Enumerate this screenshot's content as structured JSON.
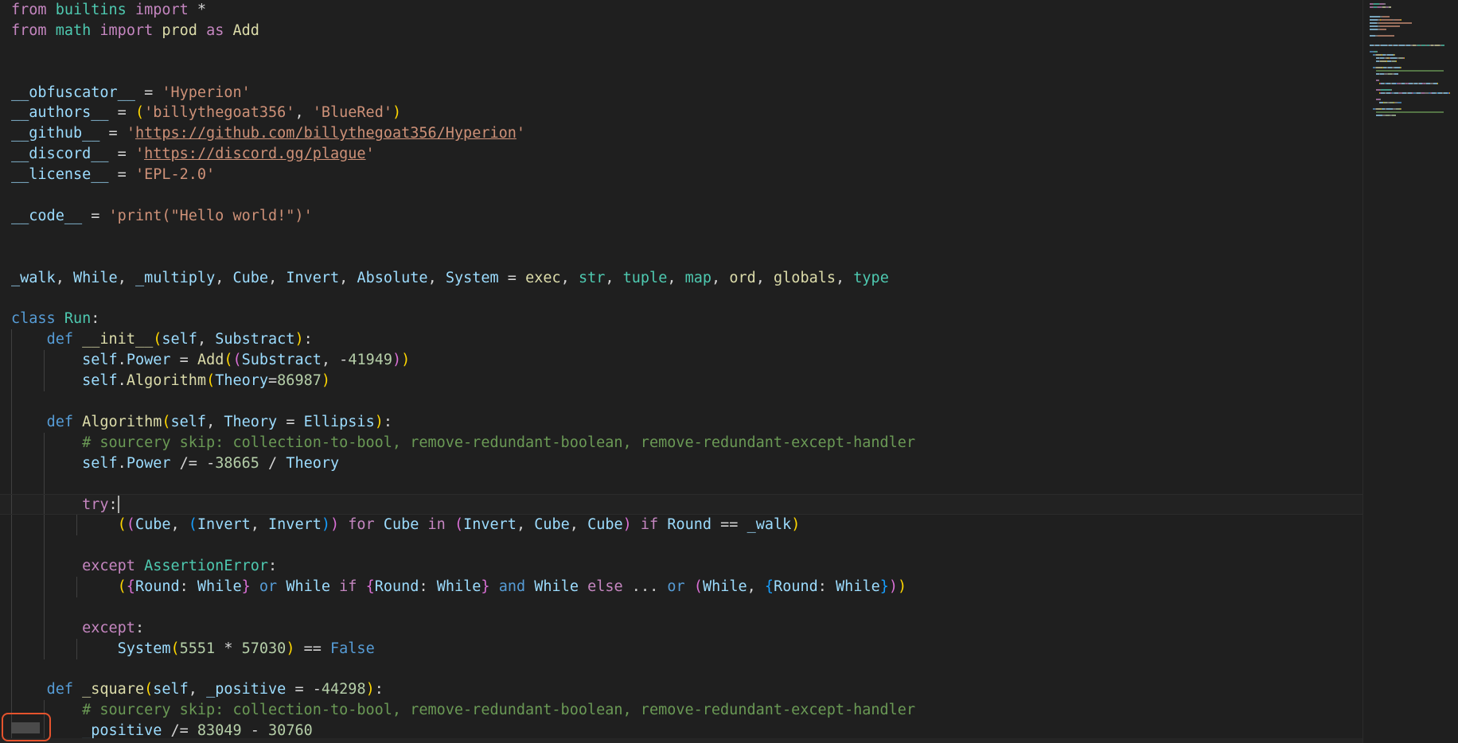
{
  "editor": {
    "lines": [
      {
        "tokens": [
          [
            "kc",
            "from"
          ],
          [
            "op",
            " "
          ],
          [
            "ty",
            "builtins"
          ],
          [
            "op",
            " "
          ],
          [
            "kc",
            "import"
          ],
          [
            "op",
            " *"
          ]
        ]
      },
      {
        "tokens": [
          [
            "kc",
            "from"
          ],
          [
            "op",
            " "
          ],
          [
            "ty",
            "math"
          ],
          [
            "op",
            " "
          ],
          [
            "kc",
            "import"
          ],
          [
            "op",
            " "
          ],
          [
            "fn",
            "prod"
          ],
          [
            "op",
            " "
          ],
          [
            "kc",
            "as"
          ],
          [
            "op",
            " "
          ],
          [
            "fn",
            "Add"
          ]
        ]
      },
      {
        "tokens": []
      },
      {
        "tokens": []
      },
      {
        "tokens": [
          [
            "vr",
            "__obfuscator__"
          ],
          [
            "op",
            " = "
          ],
          [
            "st",
            "'Hyperion'"
          ]
        ]
      },
      {
        "tokens": [
          [
            "vr",
            "__authors__"
          ],
          [
            "op",
            " = "
          ],
          [
            "b1",
            "("
          ],
          [
            "st",
            "'billythegoat356'"
          ],
          [
            "op",
            ", "
          ],
          [
            "st",
            "'BlueRed'"
          ],
          [
            "b1",
            ")"
          ]
        ]
      },
      {
        "tokens": [
          [
            "vr",
            "__github__"
          ],
          [
            "op",
            " = "
          ],
          [
            "st",
            "'"
          ],
          [
            "st ul",
            "https://github.com/billythegoat356/Hyperion"
          ],
          [
            "st",
            "'"
          ]
        ]
      },
      {
        "tokens": [
          [
            "vr",
            "__discord__"
          ],
          [
            "op",
            " = "
          ],
          [
            "st",
            "'"
          ],
          [
            "st ul",
            "https://discord.gg/plague"
          ],
          [
            "st",
            "'"
          ]
        ]
      },
      {
        "tokens": [
          [
            "vr",
            "__license__"
          ],
          [
            "op",
            " = "
          ],
          [
            "st",
            "'EPL-2.0'"
          ]
        ]
      },
      {
        "tokens": []
      },
      {
        "tokens": [
          [
            "vr",
            "__code__"
          ],
          [
            "op",
            " = "
          ],
          [
            "st",
            "'print(\"Hello world!\")'"
          ]
        ]
      },
      {
        "tokens": []
      },
      {
        "tokens": []
      },
      {
        "tokens": [
          [
            "vr",
            "_walk"
          ],
          [
            "op",
            ", "
          ],
          [
            "vr",
            "While"
          ],
          [
            "op",
            ", "
          ],
          [
            "vr",
            "_multiply"
          ],
          [
            "op",
            ", "
          ],
          [
            "vr",
            "Cube"
          ],
          [
            "op",
            ", "
          ],
          [
            "vr",
            "Invert"
          ],
          [
            "op",
            ", "
          ],
          [
            "vr",
            "Absolute"
          ],
          [
            "op",
            ", "
          ],
          [
            "vr",
            "System"
          ],
          [
            "op",
            " = "
          ],
          [
            "fn",
            "exec"
          ],
          [
            "op",
            ", "
          ],
          [
            "ty",
            "str"
          ],
          [
            "op",
            ", "
          ],
          [
            "ty",
            "tuple"
          ],
          [
            "op",
            ", "
          ],
          [
            "ty",
            "map"
          ],
          [
            "op",
            ", "
          ],
          [
            "fn",
            "ord"
          ],
          [
            "op",
            ", "
          ],
          [
            "fn",
            "globals"
          ],
          [
            "op",
            ", "
          ],
          [
            "ty",
            "type"
          ]
        ]
      },
      {
        "tokens": []
      },
      {
        "tokens": [
          [
            "kw",
            "class"
          ],
          [
            "op",
            " "
          ],
          [
            "ty",
            "Run"
          ],
          [
            "op",
            ":"
          ]
        ]
      },
      {
        "indent": 1,
        "tokens": [
          [
            "kw",
            "def"
          ],
          [
            "op",
            " "
          ],
          [
            "fn",
            "__init__"
          ],
          [
            "b1",
            "("
          ],
          [
            "vr",
            "self"
          ],
          [
            "op",
            ", "
          ],
          [
            "vr",
            "Substract"
          ],
          [
            "b1",
            ")"
          ],
          [
            "op",
            ":"
          ]
        ]
      },
      {
        "indent": 2,
        "tokens": [
          [
            "vr",
            "self"
          ],
          [
            "op",
            "."
          ],
          [
            "vr",
            "Power"
          ],
          [
            "op",
            " = "
          ],
          [
            "fn",
            "Add"
          ],
          [
            "b1",
            "("
          ],
          [
            "b2",
            "("
          ],
          [
            "vr",
            "Substract"
          ],
          [
            "op",
            ", "
          ],
          [
            "op",
            "-"
          ],
          [
            "nu",
            "41949"
          ],
          [
            "b2",
            ")"
          ],
          [
            "b1",
            ")"
          ]
        ]
      },
      {
        "indent": 2,
        "tokens": [
          [
            "vr",
            "self"
          ],
          [
            "op",
            "."
          ],
          [
            "fn",
            "Algorithm"
          ],
          [
            "b1",
            "("
          ],
          [
            "vr",
            "Theory"
          ],
          [
            "op",
            "="
          ],
          [
            "nu",
            "86987"
          ],
          [
            "b1",
            ")"
          ]
        ]
      },
      {
        "indent": 1,
        "tokens": []
      },
      {
        "indent": 1,
        "tokens": [
          [
            "kw",
            "def"
          ],
          [
            "op",
            " "
          ],
          [
            "fn",
            "Algorithm"
          ],
          [
            "b1",
            "("
          ],
          [
            "vr",
            "self"
          ],
          [
            "op",
            ", "
          ],
          [
            "vr",
            "Theory"
          ],
          [
            "op",
            " = "
          ],
          [
            "vr",
            "Ellipsis"
          ],
          [
            "b1",
            ")"
          ],
          [
            "op",
            ":"
          ]
        ]
      },
      {
        "indent": 2,
        "tokens": [
          [
            "cm",
            "# sourcery skip: collection-to-bool, remove-redundant-boolean, remove-redundant-except-handler"
          ]
        ]
      },
      {
        "indent": 2,
        "tokens": [
          [
            "vr",
            "self"
          ],
          [
            "op",
            "."
          ],
          [
            "vr",
            "Power"
          ],
          [
            "op",
            " /= -"
          ],
          [
            "nu",
            "38665"
          ],
          [
            "op",
            " / "
          ],
          [
            "vr",
            "Theory"
          ]
        ]
      },
      {
        "indent": 2,
        "tokens": []
      },
      {
        "indent": 2,
        "current": true,
        "tokens": [
          [
            "kc",
            "try"
          ],
          [
            "op",
            ":"
          ],
          [
            "cursor",
            ""
          ]
        ]
      },
      {
        "indent": 3,
        "tokens": [
          [
            "b1",
            "("
          ],
          [
            "b2",
            "("
          ],
          [
            "vr",
            "Cube"
          ],
          [
            "op",
            ", "
          ],
          [
            "b3",
            "("
          ],
          [
            "vr",
            "Invert"
          ],
          [
            "op",
            ", "
          ],
          [
            "vr",
            "Invert"
          ],
          [
            "b3",
            ")"
          ],
          [
            "b2",
            ")"
          ],
          [
            "op",
            " "
          ],
          [
            "kc",
            "for"
          ],
          [
            "op",
            " "
          ],
          [
            "vr",
            "Cube"
          ],
          [
            "op",
            " "
          ],
          [
            "kc",
            "in"
          ],
          [
            "op",
            " "
          ],
          [
            "b2",
            "("
          ],
          [
            "vr",
            "Invert"
          ],
          [
            "op",
            ", "
          ],
          [
            "vr",
            "Cube"
          ],
          [
            "op",
            ", "
          ],
          [
            "vr",
            "Cube"
          ],
          [
            "b2",
            ")"
          ],
          [
            "op",
            " "
          ],
          [
            "kc",
            "if"
          ],
          [
            "op",
            " "
          ],
          [
            "vr",
            "Round"
          ],
          [
            "op",
            " == "
          ],
          [
            "vr",
            "_walk"
          ],
          [
            "b1",
            ")"
          ]
        ]
      },
      {
        "indent": 2,
        "tokens": []
      },
      {
        "indent": 2,
        "tokens": [
          [
            "kc",
            "except"
          ],
          [
            "op",
            " "
          ],
          [
            "ty",
            "AssertionError"
          ],
          [
            "op",
            ":"
          ]
        ]
      },
      {
        "indent": 3,
        "tokens": [
          [
            "b1",
            "("
          ],
          [
            "b2",
            "{"
          ],
          [
            "vr",
            "Round"
          ],
          [
            "op",
            ": "
          ],
          [
            "vr",
            "While"
          ],
          [
            "b2",
            "}"
          ],
          [
            "op",
            " "
          ],
          [
            "kw",
            "or"
          ],
          [
            "op",
            " "
          ],
          [
            "vr",
            "While"
          ],
          [
            "op",
            " "
          ],
          [
            "kc",
            "if"
          ],
          [
            "op",
            " "
          ],
          [
            "b2",
            "{"
          ],
          [
            "vr",
            "Round"
          ],
          [
            "op",
            ": "
          ],
          [
            "vr",
            "While"
          ],
          [
            "b2",
            "}"
          ],
          [
            "op",
            " "
          ],
          [
            "kw",
            "and"
          ],
          [
            "op",
            " "
          ],
          [
            "vr",
            "While"
          ],
          [
            "op",
            " "
          ],
          [
            "kc",
            "else"
          ],
          [
            "op",
            " ... "
          ],
          [
            "kw",
            "or"
          ],
          [
            "op",
            " "
          ],
          [
            "b2",
            "("
          ],
          [
            "vr",
            "While"
          ],
          [
            "op",
            ", "
          ],
          [
            "b3",
            "{"
          ],
          [
            "vr",
            "Round"
          ],
          [
            "op",
            ": "
          ],
          [
            "vr",
            "While"
          ],
          [
            "b3",
            "}"
          ],
          [
            "b2",
            ")"
          ],
          [
            "b1",
            ")"
          ]
        ]
      },
      {
        "indent": 2,
        "tokens": []
      },
      {
        "indent": 2,
        "tokens": [
          [
            "kc",
            "except"
          ],
          [
            "op",
            ":"
          ]
        ]
      },
      {
        "indent": 3,
        "tokens": [
          [
            "vr",
            "System"
          ],
          [
            "b1",
            "("
          ],
          [
            "nu",
            "5551"
          ],
          [
            "op",
            " * "
          ],
          [
            "nu",
            "57030"
          ],
          [
            "b1",
            ")"
          ],
          [
            "op",
            " == "
          ],
          [
            "kw",
            "False"
          ]
        ]
      },
      {
        "indent": 1,
        "tokens": []
      },
      {
        "indent": 1,
        "tokens": [
          [
            "kw",
            "def"
          ],
          [
            "op",
            " "
          ],
          [
            "fn",
            "_square"
          ],
          [
            "b1",
            "("
          ],
          [
            "vr",
            "self"
          ],
          [
            "op",
            ", "
          ],
          [
            "vr",
            "_positive"
          ],
          [
            "op",
            " = -"
          ],
          [
            "nu",
            "44298"
          ],
          [
            "b1",
            ")"
          ],
          [
            "op",
            ":"
          ]
        ]
      },
      {
        "indent": 2,
        "tokens": [
          [
            "cm",
            "# sourcery skip: collection-to-bool, remove-redundant-boolean, remove-redundant-except-handler"
          ]
        ]
      },
      {
        "indent": 2,
        "tokens": [
          [
            "vr",
            "_positive"
          ],
          [
            "op",
            " /= "
          ],
          [
            "nu",
            "83049"
          ],
          [
            "op",
            " - "
          ],
          [
            "nu",
            "30760"
          ]
        ]
      }
    ]
  },
  "colors": {
    "background": "#1f1f1f",
    "keyword_control": "#c586c0",
    "keyword": "#569cd6",
    "function": "#dcdcaa",
    "type": "#4ec9b0",
    "variable": "#9cdcfe",
    "string": "#ce9178",
    "number": "#b5cea8",
    "comment": "#6a9955",
    "highlight_box": "#e5532d"
  }
}
